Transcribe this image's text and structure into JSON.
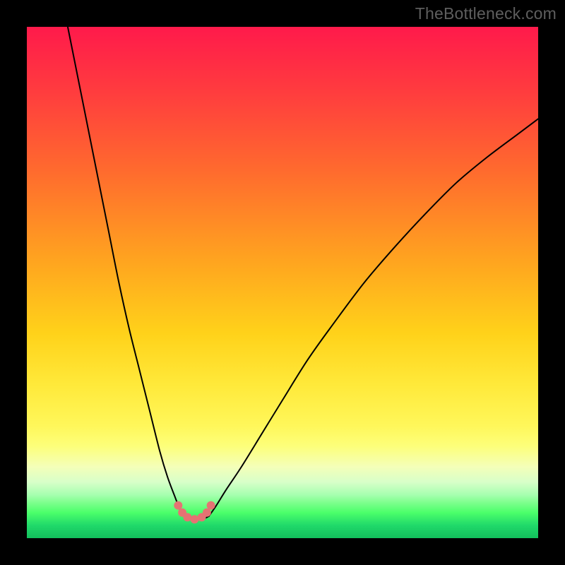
{
  "watermark": "TheBottleneck.com",
  "colors": {
    "frame": "#000000",
    "curve_stroke": "#000000",
    "dot_fill": "#e57373",
    "gradient_top": "#ff1a4b",
    "gradient_bottom": "#12c05c"
  },
  "chart_data": {
    "type": "line",
    "title": "",
    "xlabel": "",
    "ylabel": "",
    "xlim": [
      0,
      100
    ],
    "ylim": [
      0,
      100
    ],
    "grid": false,
    "note": "No axes or tick labels are rendered in the image; values below are estimated from pixel positions on a 0–100 normalized grid where (0,0) is bottom-left of the colored plot area.",
    "series": [
      {
        "name": "left-branch",
        "x": [
          8,
          10,
          12,
          14,
          16,
          18,
          20,
          22,
          24,
          26,
          27.5,
          29,
          30,
          30.8
        ],
        "y": [
          100,
          90,
          80,
          70,
          60,
          50,
          41,
          33,
          25,
          17,
          12,
          8,
          5.5,
          4.3
        ]
      },
      {
        "name": "valley-floor",
        "x": [
          30.8,
          31.6,
          32.6,
          33.8,
          34.8,
          35.6
        ],
        "y": [
          4.3,
          3.9,
          3.7,
          3.7,
          3.9,
          4.3
        ]
      },
      {
        "name": "right-branch",
        "x": [
          35.6,
          37,
          39,
          42,
          46,
          50,
          55,
          60,
          66,
          72,
          78,
          84,
          90,
          96,
          100
        ],
        "y": [
          4.3,
          6.3,
          9.5,
          14,
          20.5,
          27,
          35,
          42,
          50,
          57,
          63.5,
          69.5,
          74.5,
          79,
          82
        ]
      }
    ],
    "scatter": {
      "name": "valley-dots",
      "x": [
        29.6,
        30.4,
        31.4,
        32.8,
        34.2,
        35.2,
        36.0
      ],
      "y": [
        6.4,
        5.0,
        4.1,
        3.7,
        4.1,
        5.0,
        6.4
      ],
      "dot_radius_px": 6
    }
  }
}
